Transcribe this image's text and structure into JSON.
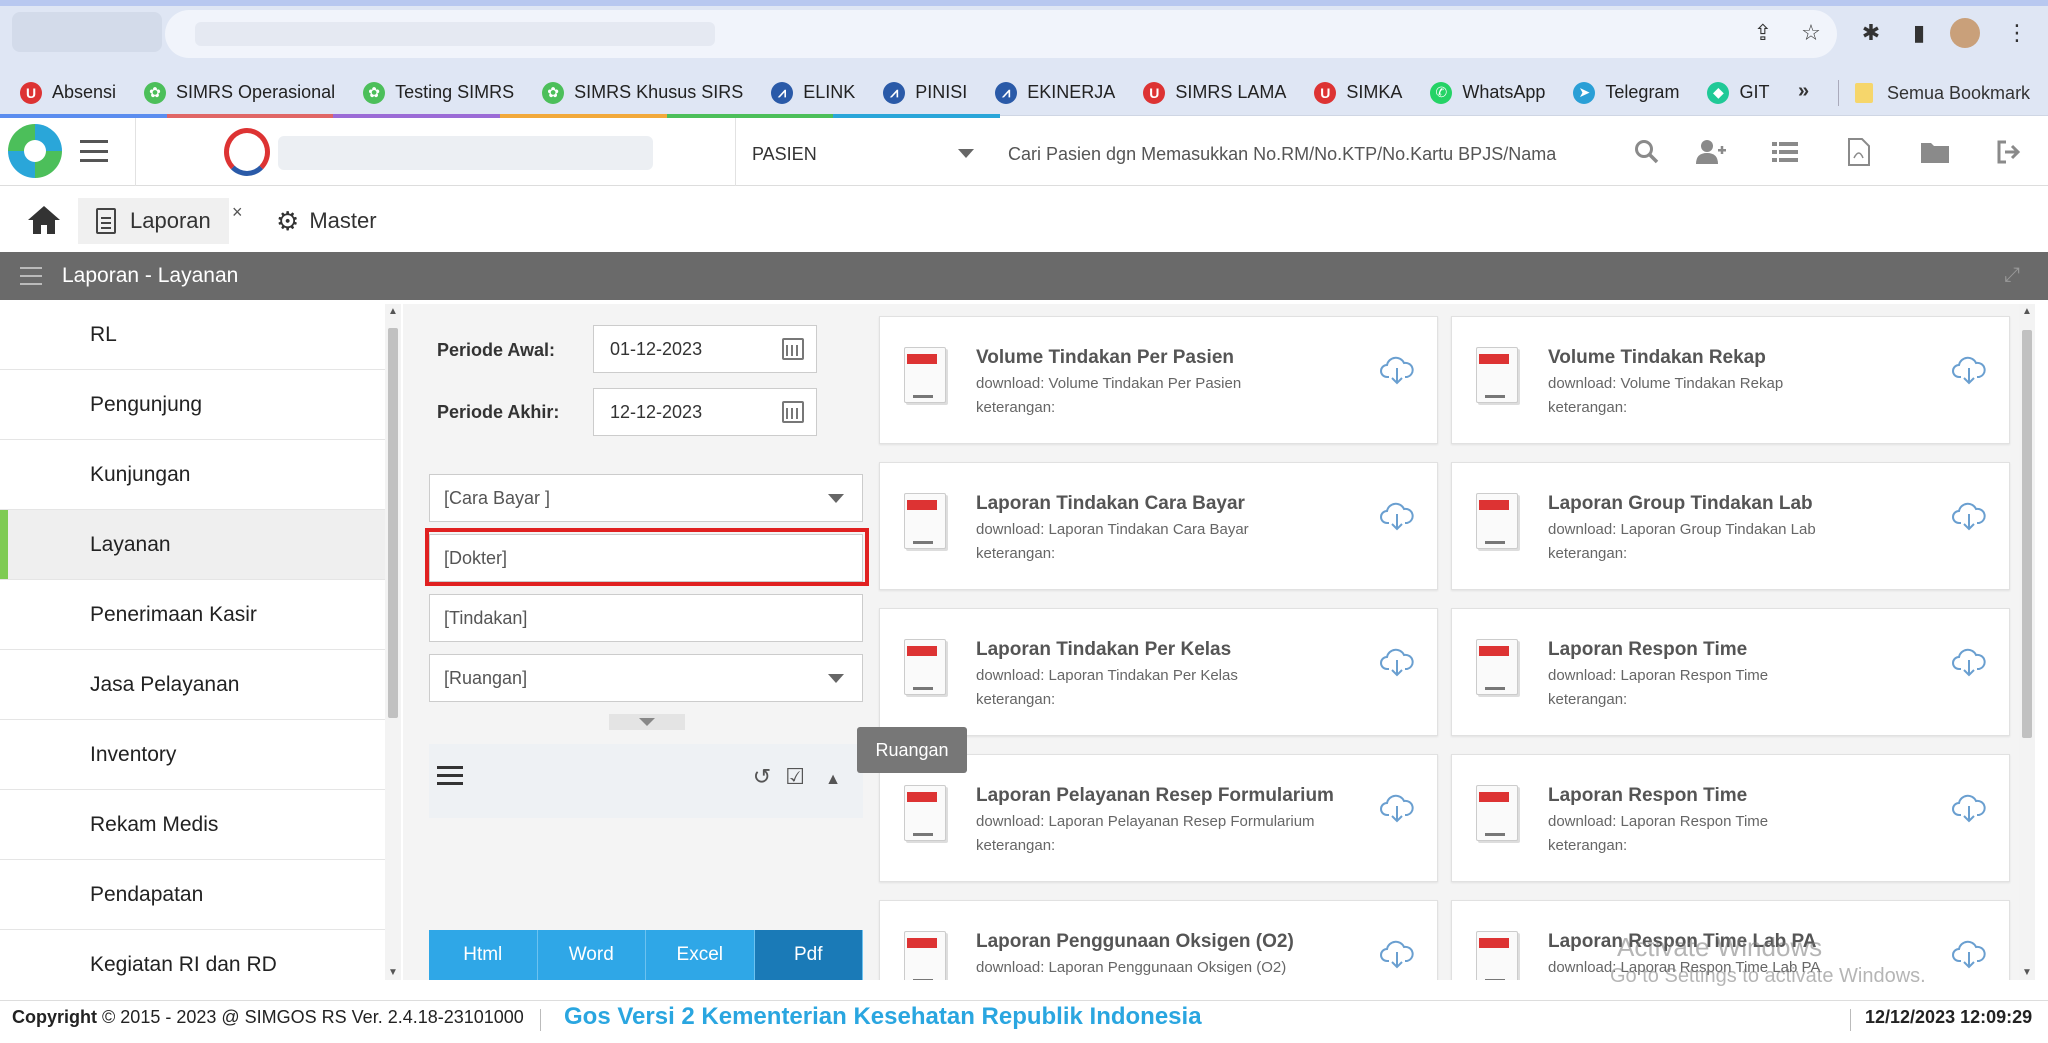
{
  "bookmarks": [
    {
      "label": "Absensi",
      "color": "#d33"
    },
    {
      "label": "SIMRS Operasional",
      "color": "#4cbf5a"
    },
    {
      "label": "Testing SIMRS",
      "color": "#4cbf5a"
    },
    {
      "label": "SIMRS Khusus SIRS",
      "color": "#4cbf5a"
    },
    {
      "label": "ELINK",
      "color": "#2a5aa8"
    },
    {
      "label": "PINISI",
      "color": "#2a5aa8"
    },
    {
      "label": "EKINERJA",
      "color": "#2a5aa8"
    },
    {
      "label": "SIMRS LAMA",
      "color": "#d33"
    },
    {
      "label": "SIMKA",
      "color": "#d33"
    },
    {
      "label": "WhatsApp",
      "color": "#25d366"
    },
    {
      "label": "Telegram",
      "color": "#2a9fd6"
    },
    {
      "label": "GIT",
      "color": "#20c997"
    }
  ],
  "bookmarks_more": "»",
  "bookmarks_all": "Semua Bookmark",
  "header": {
    "patient_select": "PASIEN",
    "search_placeholder": "Cari Pasien dgn Memasukkan No.RM/No.KTP/No.Kartu BPJS/Nama"
  },
  "tabs": [
    {
      "label": "Laporan",
      "close": "×"
    },
    {
      "label": "Master"
    }
  ],
  "section_title": "Laporan - Layanan",
  "menu": [
    "RL",
    "Pengunjung",
    "Kunjungan",
    "Layanan",
    "Penerimaan Kasir",
    "Jasa Pelayanan",
    "Inventory",
    "Rekam Medis",
    "Pendapatan",
    "Kegiatan RI dan RD"
  ],
  "filters": {
    "periode_awal_label": "Periode Awal:",
    "periode_awal_value": "01-12-2023",
    "periode_akhir_label": "Periode Akhir:",
    "periode_akhir_value": "12-12-2023",
    "cara_bayar": "[Cara Bayar ]",
    "dokter": "[Dokter]",
    "tindakan": "[Tindakan]",
    "ruangan": "[Ruangan]"
  },
  "export_buttons": [
    "Html",
    "Word",
    "Excel",
    "Pdf"
  ],
  "tooltip": "Ruangan",
  "reports": [
    {
      "title": "Volume Tindakan Per Pasien",
      "download": "download: Volume Tindakan Per Pasien",
      "ket": "keterangan:"
    },
    {
      "title": "Volume Tindakan Rekap",
      "download": "download: Volume Tindakan Rekap",
      "ket": "keterangan:"
    },
    {
      "title": "Laporan Tindakan Cara Bayar",
      "download": "download: Laporan Tindakan Cara Bayar",
      "ket": "keterangan:"
    },
    {
      "title": "Laporan Group Tindakan Lab",
      "download": "download: Laporan Group Tindakan Lab",
      "ket": "keterangan:"
    },
    {
      "title": "Laporan Tindakan Per Kelas",
      "download": "download: Laporan Tindakan Per Kelas",
      "ket": "keterangan:"
    },
    {
      "title": "Laporan Respon Time",
      "download": "download: Laporan Respon Time",
      "ket": "keterangan:"
    },
    {
      "title": "Laporan Pelayanan Resep Formularium",
      "download": "download: Laporan Pelayanan Resep Formularium",
      "ket": "keterangan:"
    },
    {
      "title": "Laporan Respon Time",
      "download": "download: Laporan Respon Time",
      "ket": "keterangan:"
    },
    {
      "title": "Laporan Penggunaan Oksigen (O2)",
      "download": "download: Laporan Penggunaan Oksigen (O2)",
      "ket": ""
    },
    {
      "title": "Laporan Respon Time Lab PA",
      "download": "download: Laporan Respon Time Lab PA",
      "ket": ""
    }
  ],
  "watermark": {
    "line1": "Activate Windows",
    "line2": "Go to Settings to activate Windows."
  },
  "footer": {
    "copyright": "Copyright",
    "copy_rest": "2015 - 2023 @ SIMGOS RS Ver. 2.4.18-23101000",
    "marquee": "Gos Versi 2 Kementerian Kesehatan Republik Indonesia",
    "clock": "12/12/2023 12:09:29"
  },
  "colors": {
    "accent": "#2fa7e7",
    "active_export": "#1a7ab7",
    "active_menu": "#7ecb53",
    "highlight": "#e02020"
  }
}
